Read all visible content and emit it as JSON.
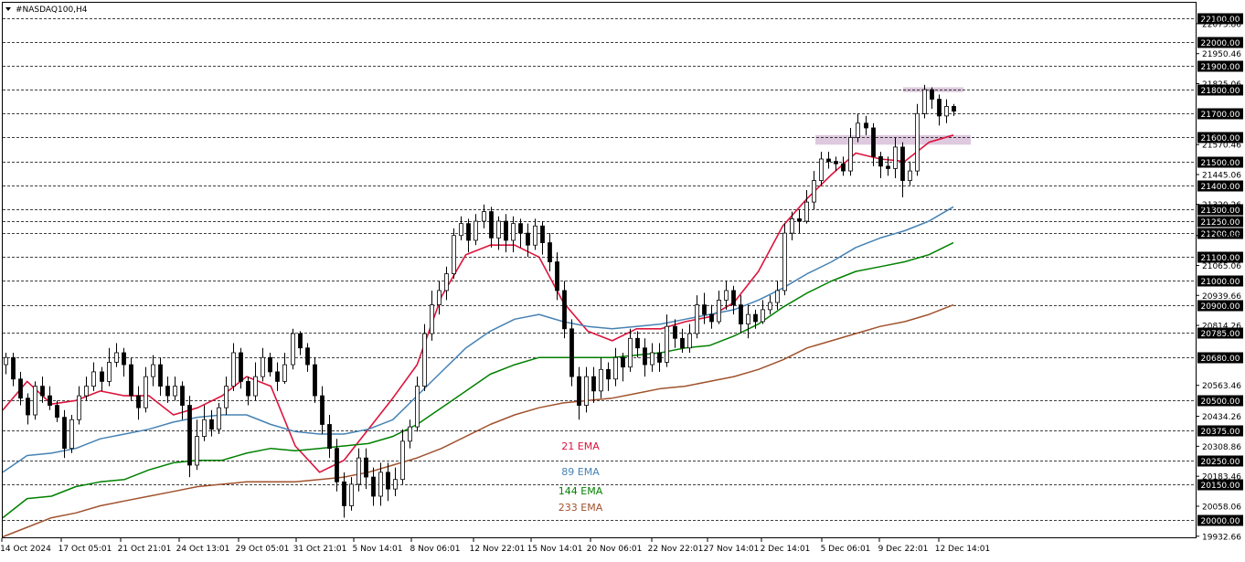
{
  "window": {
    "title": "#NASDAQ100,H4"
  },
  "chart_data": {
    "type": "candlestick",
    "symbol": "#NASDAQ100",
    "timeframe": "H4",
    "ylim": [
      19932.66,
      22125
    ],
    "grid": true,
    "price_axis_labels": [
      "22075.86",
      "21950.46",
      "21825.06",
      "21570.46",
      "21445.06",
      "21320.26",
      "21189.66",
      "21065.06",
      "20939.66",
      "20814.26",
      "20563.46",
      "20434.26",
      "20308.86",
      "20183.46",
      "20058.06",
      "19932.66"
    ],
    "price_levels": [
      "22100.00",
      "22000.00",
      "21900.00",
      "21800.00",
      "21700.00",
      "21600.00",
      "21500.00",
      "21400.00",
      "21300.00",
      "21250.00",
      "21200.00",
      "21100.00",
      "21000.00",
      "20900.00",
      "20785.00",
      "20680.00",
      "20500.00",
      "20375.00",
      "20250.00",
      "20150.00",
      "20000.00"
    ],
    "time_labels": [
      "14 Oct 2024",
      "17 Oct 05:01",
      "21 Oct 21:01",
      "24 Oct 13:01",
      "29 Oct 05:01",
      "31 Oct 21:01",
      "5 Nov 14:01",
      "8 Nov 06:01",
      "12 Nov 22:01",
      "15 Nov 14:01",
      "20 Nov 06:01",
      "22 Nov 22:01",
      "27 Nov 14:01",
      "2 Dec 14:01",
      "5 Dec 06:01",
      "9 Dec 22:01",
      "12 Dec 14:01"
    ],
    "zones": [
      {
        "name": "resistance",
        "from": 21790,
        "to": 21810,
        "color": "#d8bfd8"
      },
      {
        "name": "support",
        "from": 21570,
        "to": 21610,
        "color": "#d8bfd8"
      }
    ],
    "ema_legend": [
      {
        "label": "21 EMA",
        "color": "#dc143c"
      },
      {
        "label": "89 EMA",
        "color": "#4682b4"
      },
      {
        "label": "144 EMA",
        "color": "#008000"
      },
      {
        "label": "233 EMA",
        "color": "#a0522d"
      }
    ],
    "ema_series": [
      {
        "name": "21 EMA",
        "values": [
          20460,
          20580,
          20485,
          20500,
          20540,
          20520,
          20520,
          20440,
          20470,
          20520,
          20600,
          20560,
          20310,
          20200,
          20250,
          20380,
          20510,
          20650,
          20935,
          21110,
          21150,
          21150,
          21100,
          20910,
          20790,
          20750,
          20800,
          20800,
          20830,
          20850,
          20910,
          21040,
          21230,
          21345,
          21445,
          21535,
          21510,
          21500,
          21580,
          21610
        ]
      },
      {
        "name": "89 EMA",
        "values": [
          20200,
          20270,
          20280,
          20300,
          20340,
          20360,
          20380,
          20410,
          20430,
          20440,
          20440,
          20400,
          20370,
          20360,
          20360,
          20380,
          20420,
          20520,
          20620,
          20720,
          20790,
          20840,
          20860,
          20830,
          20810,
          20800,
          20810,
          20820,
          20840,
          20860,
          20880,
          20920,
          20970,
          21030,
          21080,
          21140,
          21180,
          21210,
          21250,
          21310
        ]
      },
      {
        "name": "144 EMA",
        "values": [
          20010,
          20090,
          20100,
          20140,
          20160,
          20170,
          20210,
          20240,
          20250,
          20250,
          20280,
          20300,
          20290,
          20300,
          20310,
          20320,
          20350,
          20400,
          20470,
          20540,
          20610,
          20650,
          20680,
          20680,
          20680,
          20680,
          20690,
          20700,
          20720,
          20730,
          20770,
          20820,
          20890,
          20950,
          21000,
          21040,
          21060,
          21080,
          21110,
          21160
        ]
      },
      {
        "name": "233 EMA",
        "values": [
          19930,
          19970,
          20010,
          20030,
          20060,
          20080,
          20100,
          20120,
          20140,
          20150,
          20160,
          20160,
          20160,
          20170,
          20180,
          20200,
          20230,
          20260,
          20300,
          20350,
          20400,
          20440,
          20470,
          20490,
          20500,
          20510,
          20530,
          20550,
          20560,
          20580,
          20600,
          20630,
          20670,
          20720,
          20750,
          20780,
          20810,
          20830,
          20860,
          20900
        ]
      }
    ],
    "candles": [
      [
        20650,
        20680,
        20700,
        20610
      ],
      [
        20680,
        20590,
        20700,
        20560
      ],
      [
        20590,
        20510,
        20620,
        20480
      ],
      [
        20510,
        20440,
        20530,
        20400
      ],
      [
        20440,
        20560,
        20580,
        20420
      ],
      [
        20560,
        20520,
        20600,
        20490
      ],
      [
        20520,
        20480,
        20560,
        20460
      ],
      [
        20480,
        20430,
        20500,
        20410
      ],
      [
        20430,
        20300,
        20460,
        20260
      ],
      [
        20300,
        20420,
        20440,
        20280
      ],
      [
        20420,
        20520,
        20560,
        20400
      ],
      [
        20520,
        20560,
        20600,
        20500
      ],
      [
        20560,
        20620,
        20660,
        20540
      ],
      [
        20620,
        20580,
        20640,
        20540
      ],
      [
        20580,
        20660,
        20720,
        20560
      ],
      [
        20660,
        20700,
        20740,
        20640
      ],
      [
        20700,
        20650,
        20720,
        20600
      ],
      [
        20650,
        20520,
        20680,
        20500
      ],
      [
        20520,
        20470,
        20560,
        20420
      ],
      [
        20470,
        20600,
        20640,
        20450
      ],
      [
        20600,
        20650,
        20690,
        20560
      ],
      [
        20650,
        20560,
        20680,
        20520
      ],
      [
        20560,
        20520,
        20600,
        20490
      ],
      [
        20520,
        20560,
        20600,
        20500
      ],
      [
        20560,
        20480,
        20580,
        20420
      ],
      [
        20480,
        20230,
        20520,
        20180
      ],
      [
        20230,
        20350,
        20420,
        20210
      ],
      [
        20350,
        20420,
        20480,
        20330
      ],
      [
        20420,
        20380,
        20460,
        20350
      ],
      [
        20380,
        20470,
        20490,
        20360
      ],
      [
        20470,
        20560,
        20600,
        20440
      ],
      [
        20560,
        20700,
        20740,
        20540
      ],
      [
        20700,
        20580,
        20720,
        20550
      ],
      [
        20580,
        20520,
        20600,
        20480
      ],
      [
        20520,
        20600,
        20660,
        20500
      ],
      [
        20600,
        20680,
        20720,
        20580
      ],
      [
        20680,
        20620,
        20700,
        20600
      ],
      [
        20620,
        20580,
        20660,
        20540
      ],
      [
        20580,
        20650,
        20700,
        20570
      ],
      [
        20650,
        20780,
        20800,
        20630
      ],
      [
        20780,
        20720,
        20790,
        20690
      ],
      [
        20720,
        20650,
        20740,
        20620
      ],
      [
        20650,
        20520,
        20680,
        20490
      ],
      [
        20520,
        20400,
        20560,
        20360
      ],
      [
        20400,
        20300,
        20440,
        20260
      ],
      [
        20300,
        20160,
        20340,
        20120
      ],
      [
        20160,
        20060,
        20200,
        20010
      ],
      [
        20060,
        20150,
        20180,
        20040
      ],
      [
        20150,
        20260,
        20300,
        20120
      ],
      [
        20260,
        20180,
        20300,
        20130
      ],
      [
        20180,
        20100,
        20220,
        20060
      ],
      [
        20100,
        20200,
        20240,
        20060
      ],
      [
        20200,
        20130,
        20240,
        20080
      ],
      [
        20130,
        20170,
        20220,
        20100
      ],
      [
        20170,
        20330,
        20380,
        20150
      ],
      [
        20330,
        20390,
        20420,
        20300
      ],
      [
        20390,
        20560,
        20600,
        20370
      ],
      [
        20560,
        20780,
        20820,
        20540
      ],
      [
        20780,
        20900,
        20960,
        20750
      ],
      [
        20900,
        20960,
        21000,
        20860
      ],
      [
        20960,
        21030,
        21060,
        20920
      ],
      [
        21030,
        21190,
        21220,
        21010
      ],
      [
        21190,
        21240,
        21270,
        21170
      ],
      [
        21240,
        21170,
        21260,
        21120
      ],
      [
        21170,
        21250,
        21280,
        21150
      ],
      [
        21250,
        21290,
        21320,
        21220
      ],
      [
        21290,
        21180,
        21310,
        21140
      ],
      [
        21180,
        21250,
        21270,
        21130
      ],
      [
        21250,
        21170,
        21280,
        21120
      ],
      [
        21170,
        21240,
        21270,
        21120
      ],
      [
        21240,
        21200,
        21260,
        21140
      ],
      [
        21200,
        21150,
        21240,
        21100
      ],
      [
        21150,
        21230,
        21260,
        21130
      ],
      [
        21230,
        21160,
        21250,
        21110
      ],
      [
        21160,
        21080,
        21200,
        21040
      ],
      [
        21080,
        20960,
        21120,
        20920
      ],
      [
        20960,
        20800,
        21000,
        20760
      ],
      [
        20800,
        20600,
        20840,
        20560
      ],
      [
        20600,
        20480,
        20640,
        20420
      ],
      [
        20480,
        20600,
        20640,
        20450
      ],
      [
        20600,
        20540,
        20640,
        20490
      ],
      [
        20540,
        20630,
        20680,
        20510
      ],
      [
        20630,
        20590,
        20660,
        20540
      ],
      [
        20590,
        20680,
        20720,
        20560
      ],
      [
        20680,
        20640,
        20700,
        20580
      ],
      [
        20640,
        20760,
        20800,
        20620
      ],
      [
        20760,
        20720,
        20790,
        20680
      ],
      [
        20720,
        20650,
        20760,
        20600
      ],
      [
        20650,
        20700,
        20740,
        20620
      ],
      [
        20700,
        20660,
        20740,
        20620
      ],
      [
        20660,
        20810,
        20860,
        20640
      ],
      [
        20810,
        20760,
        20840,
        20720
      ],
      [
        20760,
        20720,
        20800,
        20700
      ],
      [
        20720,
        20780,
        20820,
        20700
      ],
      [
        20780,
        20900,
        20940,
        20760
      ],
      [
        20900,
        20860,
        20950,
        20820
      ],
      [
        20860,
        20830,
        20900,
        20800
      ],
      [
        20830,
        20920,
        20960,
        20820
      ],
      [
        20920,
        20960,
        21000,
        20880
      ],
      [
        20960,
        20900,
        20980,
        20860
      ],
      [
        20900,
        20820,
        20940,
        20780
      ],
      [
        20820,
        20860,
        20900,
        20760
      ],
      [
        20860,
        20830,
        20880,
        20800
      ],
      [
        20830,
        20880,
        20920,
        20820
      ],
      [
        20880,
        20910,
        20940,
        20860
      ],
      [
        20910,
        20960,
        21000,
        20880
      ],
      [
        20960,
        21200,
        21240,
        20940
      ],
      [
        21200,
        21260,
        21290,
        21170
      ],
      [
        21260,
        21250,
        21300,
        21200
      ],
      [
        21250,
        21330,
        21380,
        21240
      ],
      [
        21330,
        21420,
        21460,
        21300
      ],
      [
        21420,
        21510,
        21540,
        21400
      ],
      [
        21510,
        21500,
        21540,
        21470
      ],
      [
        21500,
        21490,
        21520,
        21460
      ],
      [
        21490,
        21460,
        21520,
        21440
      ],
      [
        21460,
        21600,
        21640,
        21440
      ],
      [
        21600,
        21660,
        21700,
        21580
      ],
      [
        21660,
        21640,
        21690,
        21610
      ],
      [
        21640,
        21520,
        21660,
        21480
      ],
      [
        21520,
        21480,
        21540,
        21430
      ],
      [
        21480,
        21470,
        21520,
        21440
      ],
      [
        21470,
        21560,
        21600,
        21430
      ],
      [
        21560,
        21420,
        21580,
        21350
      ],
      [
        21420,
        21460,
        21500,
        21400
      ],
      [
        21460,
        21700,
        21740,
        21440
      ],
      [
        21700,
        21800,
        21820,
        21680
      ],
      [
        21800,
        21760,
        21810,
        21720
      ],
      [
        21760,
        21690,
        21780,
        21650
      ],
      [
        21690,
        21730,
        21760,
        21660
      ],
      [
        21730,
        21710,
        21740,
        21690
      ]
    ]
  }
}
